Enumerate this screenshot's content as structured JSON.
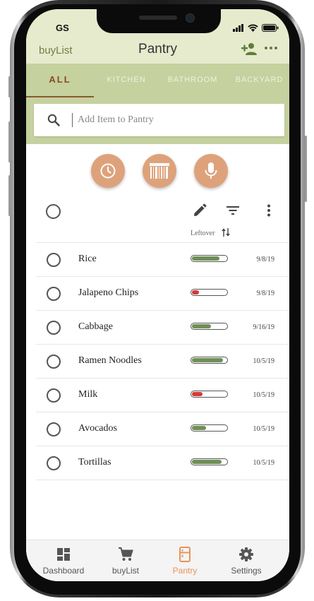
{
  "status_bar": {
    "carrier": "GS"
  },
  "header": {
    "brand": "buyList",
    "title": "Pantry",
    "add_user_icon": "add-person-icon",
    "more_icon": "more-horizontal-icon"
  },
  "colors": {
    "header_bg": "#e7ebcd",
    "tabs_bg": "#c5d19f",
    "accent_orange": "#dea27b",
    "active_nav": "#e8945a",
    "bar_green": "#6f8f57",
    "bar_red": "#d33a3a"
  },
  "tabs": [
    {
      "label": "ALL",
      "active": true
    },
    {
      "label": "KITCHEN",
      "active": false
    },
    {
      "label": "BATHROOM",
      "active": false
    },
    {
      "label": "BACKYARD",
      "active": false
    }
  ],
  "search": {
    "placeholder": "Add Item to Pantry",
    "value": ""
  },
  "actions": [
    {
      "name": "history-button",
      "icon": "clock-icon"
    },
    {
      "name": "barcode-button",
      "icon": "barcode-icon"
    },
    {
      "name": "voice-button",
      "icon": "microphone-icon"
    }
  ],
  "toolbar": {
    "leftover_label": "Leftover",
    "icons": [
      "edit-icon",
      "filter-icon",
      "more-vertical-icon"
    ]
  },
  "items": [
    {
      "name": "Rice",
      "leftover": 0.8,
      "level": "good",
      "date": "9/8/19"
    },
    {
      "name": "Jalapeno Chips",
      "leftover": 0.2,
      "level": "low",
      "date": "9/8/19"
    },
    {
      "name": "Cabbage",
      "leftover": 0.55,
      "level": "good",
      "date": "9/16/19"
    },
    {
      "name": "Ramen Noodles",
      "leftover": 0.9,
      "level": "good",
      "date": "10/5/19"
    },
    {
      "name": "Milk",
      "leftover": 0.3,
      "level": "low",
      "date": "10/5/19"
    },
    {
      "name": "Avocados",
      "leftover": 0.4,
      "level": "good",
      "date": "10/5/19"
    },
    {
      "name": "Tortillas",
      "leftover": 0.85,
      "level": "good",
      "date": "10/5/19"
    }
  ],
  "bottom_nav": [
    {
      "label": "Dashboard",
      "icon": "dashboard-icon",
      "active": false
    },
    {
      "label": "buyList",
      "icon": "cart-icon",
      "active": false
    },
    {
      "label": "Pantry",
      "icon": "fridge-icon",
      "active": true
    },
    {
      "label": "Settings",
      "icon": "gear-icon",
      "active": false
    }
  ]
}
